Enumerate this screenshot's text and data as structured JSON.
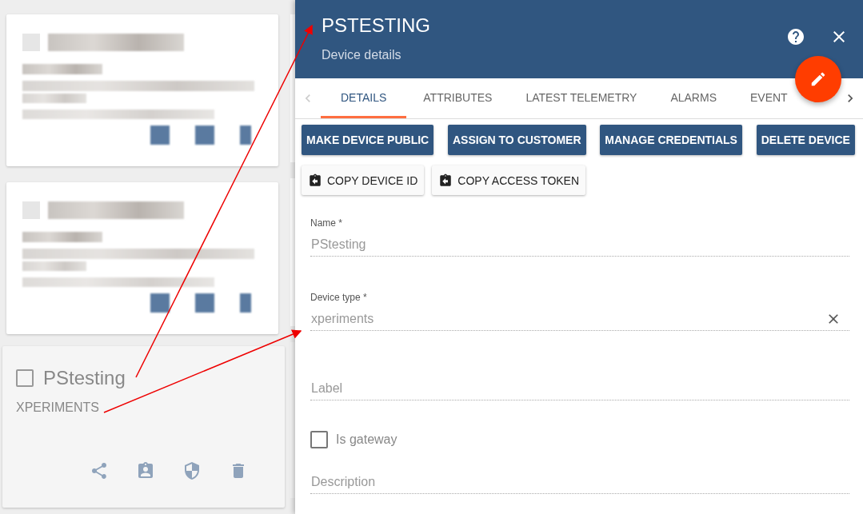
{
  "device_cards": [
    {
      "kind": "blurred",
      "checked": false
    },
    {
      "kind": "blurred",
      "checked": false
    },
    {
      "kind": "card",
      "name": "PStesting",
      "type": "XPERIMENTS",
      "checked": false
    }
  ],
  "panel": {
    "title": "PSTESTING",
    "subtitle": "Device details",
    "tabs": [
      {
        "label": "DETAILS",
        "selected": true
      },
      {
        "label": "ATTRIBUTES",
        "selected": false
      },
      {
        "label": "LATEST TELEMETRY",
        "selected": false
      },
      {
        "label": "ALARMS",
        "selected": false
      },
      {
        "label": "EVENT",
        "selected": false
      }
    ],
    "action_buttons": [
      "MAKE DEVICE PUBLIC",
      "ASSIGN TO CUSTOMER",
      "MANAGE CREDENTIALS",
      "DELETE DEVICE"
    ],
    "copy_buttons": [
      "COPY DEVICE ID",
      "COPY ACCESS TOKEN"
    ],
    "fields": [
      {
        "kind": "input",
        "label": "Name *",
        "value": "PStesting",
        "clearable": false
      },
      {
        "kind": "input",
        "label": "Device type *",
        "value": "xperiments",
        "clearable": true
      },
      {
        "kind": "input",
        "placeholder": "Label",
        "clearable": false
      },
      {
        "kind": "checkbox",
        "label": "Is gateway",
        "checked": false
      },
      {
        "kind": "input",
        "placeholder": "Description",
        "clearable": false
      }
    ]
  }
}
